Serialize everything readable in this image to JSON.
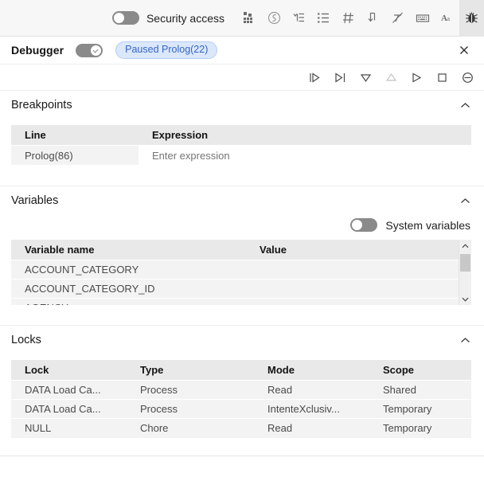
{
  "toolbar": {
    "security_toggle_label": "Security access",
    "security_toggle_state": "off",
    "icons": [
      {
        "name": "dataset-icon",
        "title": "Dataset"
      },
      {
        "name": "sandbox-icon",
        "title": "Sandbox"
      },
      {
        "name": "subset-tree-icon",
        "title": "Subset tree"
      },
      {
        "name": "ordered-list-icon",
        "title": "Ordered list"
      },
      {
        "name": "grid-icon",
        "title": "Grid"
      },
      {
        "name": "insert-below-icon",
        "title": "Insert below"
      },
      {
        "name": "no-format-icon",
        "title": "Clear formatting"
      },
      {
        "name": "keyboard-icon",
        "title": "Keyboard"
      },
      {
        "name": "font-icon",
        "title": "Font"
      },
      {
        "name": "debugger-bug-icon",
        "title": "Debugger"
      }
    ]
  },
  "debugger": {
    "title": "Debugger",
    "toggle_state": "on",
    "status_badge": "Paused Prolog(22)",
    "close_label": "×",
    "controls": [
      {
        "name": "step-into-button",
        "label": "Step into",
        "enabled": true
      },
      {
        "name": "step-over-button",
        "label": "Step over",
        "enabled": true
      },
      {
        "name": "step-down-button",
        "label": "Step down",
        "enabled": true
      },
      {
        "name": "step-up-button",
        "label": "Step up",
        "enabled": false
      },
      {
        "name": "continue-button",
        "label": "Continue",
        "enabled": true
      },
      {
        "name": "stop-button",
        "label": "Stop",
        "enabled": true
      },
      {
        "name": "disable-breakpoints-button",
        "label": "Disable breakpoints",
        "enabled": true
      }
    ]
  },
  "breakpoints": {
    "title": "Breakpoints",
    "collapse_state": "expanded",
    "columns": [
      "Line",
      "Expression"
    ],
    "rows": [
      {
        "line": "Prolog(86)",
        "expression": "",
        "expression_placeholder": "Enter expression"
      }
    ]
  },
  "variables": {
    "title": "Variables",
    "collapse_state": "expanded",
    "system_variables_label": "System variables",
    "system_variables_state": "off",
    "columns": [
      "Variable name",
      "Value"
    ],
    "rows": [
      {
        "name": "ACCOUNT_CATEGORY",
        "value": ""
      },
      {
        "name": "ACCOUNT_CATEGORY_ID",
        "value": ""
      },
      {
        "name": "AGENCY",
        "value": ""
      }
    ]
  },
  "locks": {
    "title": "Locks",
    "collapse_state": "expanded",
    "columns": [
      "Lock",
      "Type",
      "Mode",
      "Scope"
    ],
    "rows": [
      {
        "lock": "DATA Load Ca...",
        "type": "Process",
        "mode": "Read",
        "scope": "Shared"
      },
      {
        "lock": "DATA Load Ca...",
        "type": "Process",
        "mode": "IntenteXclusiv...",
        "scope": "Temporary"
      },
      {
        "lock": "NULL",
        "type": "Chore",
        "mode": "Read",
        "scope": "Temporary"
      }
    ]
  },
  "colors": {
    "badge_bg": "#dbe8fb",
    "badge_text": "#3565c4",
    "toolbar_bg": "#f7f7f7",
    "header_row_bg": "#e9e9e9",
    "row_bg": "#f3f3f3",
    "toggle_off": "#8a8a8a"
  }
}
